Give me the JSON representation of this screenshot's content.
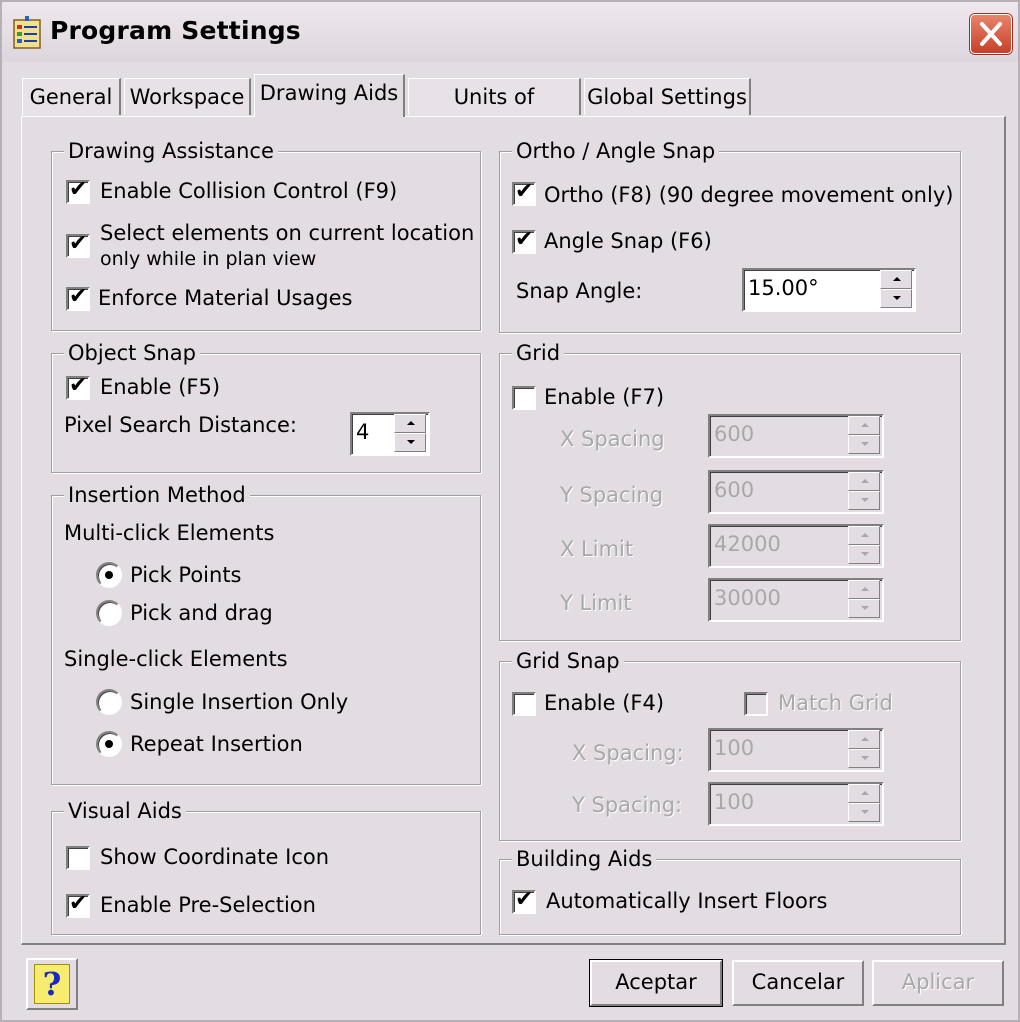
{
  "window": {
    "title": "Program Settings",
    "close_icon": "close-icon",
    "app_icon": "settings-list-icon"
  },
  "tabs": [
    {
      "label": "General"
    },
    {
      "label": "Workspace"
    },
    {
      "label": "Drawing Aids",
      "active": true
    },
    {
      "label": "Units of Measure"
    },
    {
      "label": "Global Settings"
    }
  ],
  "drawing_assistance": {
    "legend": "Drawing Assistance",
    "collision": {
      "label": "Enable Collision Control (F9)",
      "checked": true
    },
    "select_line1": "Select elements on current location",
    "select_line2": "only while in plan view",
    "select_checked": true,
    "material": {
      "label": "Enforce Material Usages",
      "checked": true
    }
  },
  "object_snap": {
    "legend": "Object Snap",
    "enable": {
      "label": "Enable (F5)",
      "checked": true
    },
    "pixel_label": "Pixel Search Distance:",
    "pixel_value": "4"
  },
  "insertion_method": {
    "legend": "Insertion Method",
    "multi_label": "Multi-click Elements",
    "pick_points": "Pick Points",
    "pick_drag": "Pick and drag",
    "multi_selected": "Pick Points",
    "single_label": "Single-click Elements",
    "single_only": "Single Insertion Only",
    "repeat": "Repeat Insertion",
    "single_selected": "Repeat Insertion"
  },
  "visual_aids": {
    "legend": "Visual Aids",
    "coord": {
      "label": "Show Coordinate Icon",
      "checked": false
    },
    "preselect": {
      "label": "Enable Pre-Selection",
      "checked": true
    }
  },
  "ortho": {
    "legend": "Ortho / Angle Snap",
    "ortho": {
      "label": "Ortho (F8)  (90 degree movement only)",
      "checked": true
    },
    "angle": {
      "label": "Angle Snap (F6)",
      "checked": true
    },
    "snap_angle_label": "Snap Angle:",
    "snap_angle_value": "15.00°"
  },
  "grid": {
    "legend": "Grid",
    "enable": {
      "label": "Enable (F7)",
      "checked": false
    },
    "x_spacing_label": "X Spacing",
    "x_spacing_value": "600",
    "y_spacing_label": "Y Spacing",
    "y_spacing_value": "600",
    "x_limit_label": "X Limit",
    "x_limit_value": "42000",
    "y_limit_label": "Y Limit",
    "y_limit_value": "30000"
  },
  "grid_snap": {
    "legend": "Grid Snap",
    "enable": {
      "label": "Enable (F4)",
      "checked": false
    },
    "match": {
      "label": "Match Grid",
      "checked": false
    },
    "x_spacing_label": "X Spacing:",
    "x_spacing_value": "100",
    "y_spacing_label": "Y Spacing:",
    "y_spacing_value": "100"
  },
  "building_aids": {
    "legend": "Building Aids",
    "floors": {
      "label": "Automatically Insert Floors",
      "checked": true
    }
  },
  "buttons": {
    "help": "?",
    "ok": "Aceptar",
    "cancel": "Cancelar",
    "apply": "Aplicar"
  },
  "check_glyph": "✔"
}
